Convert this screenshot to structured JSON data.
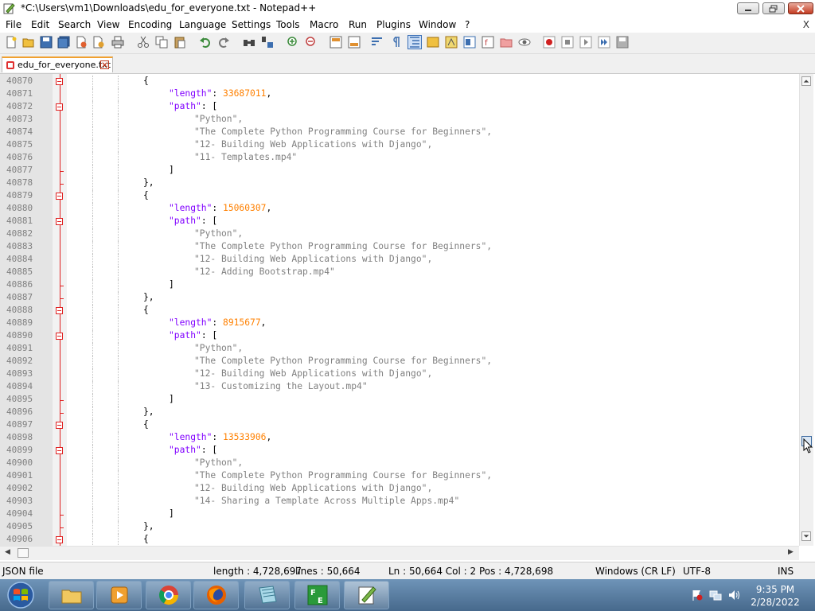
{
  "window": {
    "title": "*C:\\Users\\vm1\\Downloads\\edu_for_everyone.txt - Notepad++"
  },
  "menu": {
    "items": [
      "File",
      "Edit",
      "Search",
      "View",
      "Encoding",
      "Language",
      "Settings",
      "Tools",
      "Macro",
      "Run",
      "Plugins",
      "Window",
      "?"
    ],
    "close_doc": "X"
  },
  "tab": {
    "label": "edu_for_everyone.txt"
  },
  "editor": {
    "lines": [
      {
        "no": "40870",
        "text": "{",
        "indent": 3
      },
      {
        "no": "40871",
        "key": "\"length\"",
        "num": "33687011",
        "indent": 4
      },
      {
        "no": "40872",
        "key": "\"path\"",
        "open": "[",
        "indent": 4
      },
      {
        "no": "40873",
        "str": "\"Python\",",
        "indent": 5
      },
      {
        "no": "40874",
        "str": "\"The Complete Python Programming Course for Beginners\",",
        "indent": 5
      },
      {
        "no": "40875",
        "str": "\"12- Building Web Applications with Django\",",
        "indent": 5
      },
      {
        "no": "40876",
        "str": "\"11- Templates.mp4\"",
        "indent": 5
      },
      {
        "no": "40877",
        "text": "]",
        "indent": 4
      },
      {
        "no": "40878",
        "text": "},",
        "indent": 3
      },
      {
        "no": "40879",
        "text": "{",
        "indent": 3
      },
      {
        "no": "40880",
        "key": "\"length\"",
        "num": "15060307",
        "indent": 4
      },
      {
        "no": "40881",
        "key": "\"path\"",
        "open": "[",
        "indent": 4
      },
      {
        "no": "40882",
        "str": "\"Python\",",
        "indent": 5
      },
      {
        "no": "40883",
        "str": "\"The Complete Python Programming Course for Beginners\",",
        "indent": 5
      },
      {
        "no": "40884",
        "str": "\"12- Building Web Applications with Django\",",
        "indent": 5
      },
      {
        "no": "40885",
        "str": "\"12- Adding Bootstrap.mp4\"",
        "indent": 5
      },
      {
        "no": "40886",
        "text": "]",
        "indent": 4
      },
      {
        "no": "40887",
        "text": "},",
        "indent": 3
      },
      {
        "no": "40888",
        "text": "{",
        "indent": 3
      },
      {
        "no": "40889",
        "key": "\"length\"",
        "num": "8915677",
        "indent": 4
      },
      {
        "no": "40890",
        "key": "\"path\"",
        "open": "[",
        "indent": 4
      },
      {
        "no": "40891",
        "str": "\"Python\",",
        "indent": 5
      },
      {
        "no": "40892",
        "str": "\"The Complete Python Programming Course for Beginners\",",
        "indent": 5
      },
      {
        "no": "40893",
        "str": "\"12- Building Web Applications with Django\",",
        "indent": 5
      },
      {
        "no": "40894",
        "str": "\"13- Customizing the Layout.mp4\"",
        "indent": 5
      },
      {
        "no": "40895",
        "text": "]",
        "indent": 4
      },
      {
        "no": "40896",
        "text": "},",
        "indent": 3
      },
      {
        "no": "40897",
        "text": "{",
        "indent": 3
      },
      {
        "no": "40898",
        "key": "\"length\"",
        "num": "13533906",
        "indent": 4
      },
      {
        "no": "40899",
        "key": "\"path\"",
        "open": "[",
        "indent": 4
      },
      {
        "no": "40900",
        "str": "\"Python\",",
        "indent": 5
      },
      {
        "no": "40901",
        "str": "\"The Complete Python Programming Course for Beginners\",",
        "indent": 5
      },
      {
        "no": "40902",
        "str": "\"12- Building Web Applications with Django\",",
        "indent": 5
      },
      {
        "no": "40903",
        "str": "\"14- Sharing a Template Across Multiple Apps.mp4\"",
        "indent": 5
      },
      {
        "no": "40904",
        "text": "]",
        "indent": 4
      },
      {
        "no": "40905",
        "text": "},",
        "indent": 3
      },
      {
        "no": "40906",
        "text": "{",
        "indent": 3
      }
    ]
  },
  "status": {
    "filetype": "JSON file",
    "length": "length : 4,728,697",
    "lines": "lines : 50,664",
    "position": "Ln : 50,664    Col : 2    Pos : 4,728,698",
    "eol": "Windows (CR LF)",
    "encoding": "UTF-8",
    "mode": "INS"
  },
  "taskbar": {
    "time": "9:35 PM",
    "date": "2/28/2022"
  },
  "colors": {
    "keyword": "#8000ff",
    "number": "#ff8000",
    "string": "#808080",
    "fold_marker": "#e02020"
  }
}
